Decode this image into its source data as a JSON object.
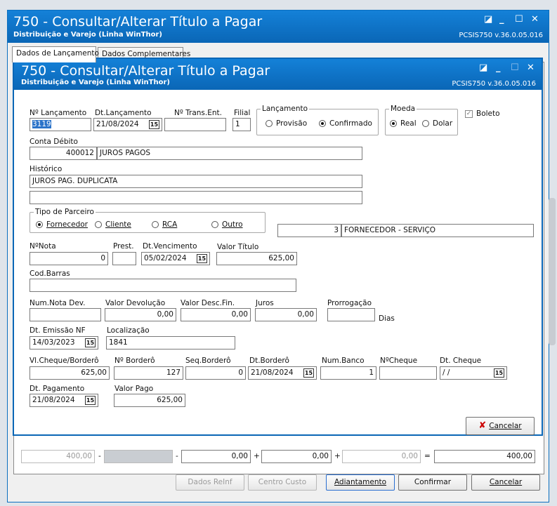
{
  "outer": {
    "title": "750 - Consultar/Alterar Título a Pagar",
    "subtitle": "Distribuição e Varejo (Linha WinThor)",
    "version": "PCSIS750  v.36.0.05.016"
  },
  "tabs": [
    {
      "label": "Dados de Lançamento"
    },
    {
      "label": "Dados Complementares"
    }
  ],
  "inner": {
    "title": "750 - Consultar/Alterar Título a Pagar",
    "subtitle": "Distribuição e Varejo (Linha WinThor)",
    "version": "PCSIS750  v.36.0.05.016"
  },
  "form": {
    "num_lancamento": {
      "label": "Nº Lançamento",
      "value": "3119"
    },
    "dt_lancamento": {
      "label": "Dt.Lançamento",
      "value": "21/08/2024"
    },
    "num_trans": {
      "label": "Nº Trans.Ent.",
      "value": ""
    },
    "filial": {
      "label": "Filial",
      "value": "1"
    },
    "lancamento": {
      "label": "Lançamento",
      "opt1": "Provisão",
      "opt2": "Confirmado"
    },
    "moeda": {
      "label": "Moeda",
      "opt1": "Real",
      "opt2": "Dolar"
    },
    "boleto": {
      "label": "Boleto"
    },
    "conta_debito": {
      "label": "Conta Débito",
      "code": "400012",
      "desc": "JUROS PAGOS"
    },
    "historico": {
      "label": "Histórico",
      "line1": "JUROS PAG. DUPLICATA",
      "line2": ""
    },
    "tipo_parceiro": {
      "label": "Tipo de Parceiro",
      "opt1": "Fornecedor",
      "opt2": "Cliente",
      "opt3": "RCA",
      "opt4": "Outro"
    },
    "parceiro": {
      "code": "3",
      "desc": "FORNECEDOR - SERVIÇO"
    },
    "num_nota": {
      "label": "NºNota",
      "value": "0"
    },
    "prest": {
      "label": "Prest.",
      "value": ""
    },
    "dt_vencimento": {
      "label": "Dt.Vencimento",
      "value": "05/02/2024"
    },
    "valor_titulo": {
      "label": "Valor Título",
      "value": "625,00"
    },
    "cod_barras": {
      "label": "Cod.Barras",
      "value": ""
    },
    "num_nota_dev": {
      "label": "Num.Nota Dev.",
      "value": ""
    },
    "valor_devolucao": {
      "label": "Valor Devolução",
      "value": "0,00"
    },
    "valor_desc_fin": {
      "label": "Valor Desc.Fin.",
      "value": "0,00"
    },
    "juros": {
      "label": "Juros",
      "value": "0,00"
    },
    "prorrogacao": {
      "label": "Prorrogação",
      "value": "",
      "unit": "Dias"
    },
    "dt_emissao": {
      "label": "Dt. Emissão NF",
      "value": "14/03/2023"
    },
    "localizacao": {
      "label": "Localização",
      "value": "1841"
    },
    "vl_cheque": {
      "label": "Vl.Cheque/Borderô",
      "value": "625,00"
    },
    "num_bordero": {
      "label": "Nº Borderô",
      "value": "127"
    },
    "seq_bordero": {
      "label": "Seq.Borderô",
      "value": "0"
    },
    "dt_bordero": {
      "label": "Dt.Borderô",
      "value": "21/08/2024"
    },
    "num_banco": {
      "label": "Num.Banco",
      "value": "1"
    },
    "num_cheque": {
      "label": "NºCheque",
      "value": ""
    },
    "dt_cheque": {
      "label": "Dt. Cheque",
      "value": " / /"
    },
    "dt_pagamento": {
      "label": "Dt. Pagamento",
      "value": "21/08/2024"
    },
    "valor_pago": {
      "label": "Valor Pago",
      "value": "625,00"
    },
    "cancel": "Cancelar"
  },
  "behind": {
    "v1": "400,00",
    "op1": "-",
    "op2": "-",
    "v3": "0,00",
    "op3": "+",
    "v4": "0,00",
    "op4": "+",
    "v5": "0,00",
    "op5": "=",
    "v6": "400,00"
  },
  "buttons": {
    "dados_reinf": "Dados ReInf",
    "centro_custo": "Centro Custo",
    "adiantamento": "Adiantamento",
    "confirmar": "Confirmar",
    "cancelar": "Cancelar"
  }
}
